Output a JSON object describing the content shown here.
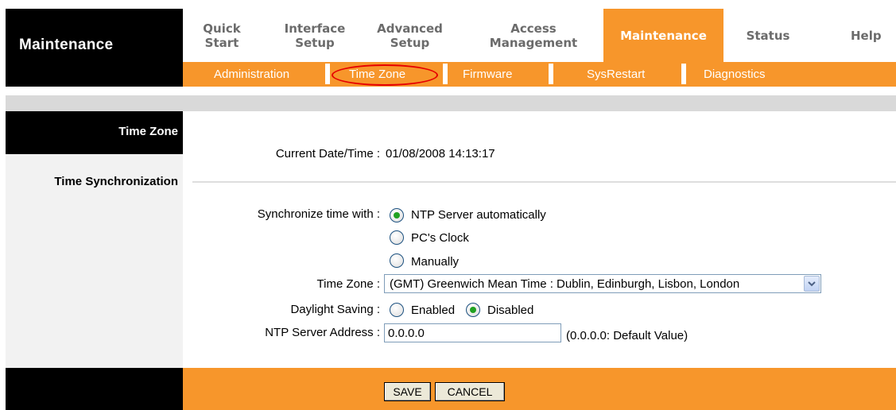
{
  "brand": {
    "title": "Maintenance"
  },
  "topnav": {
    "quick_start": [
      "Quick",
      "Start"
    ],
    "interface_setup": [
      "Interface",
      "Setup"
    ],
    "advanced_setup": [
      "Advanced",
      "Setup"
    ],
    "access_management": [
      "Access",
      "Management"
    ],
    "maintenance": "Maintenance",
    "status": "Status",
    "help": "Help"
  },
  "subnav": {
    "administration": "Administration",
    "time_zone": "Time Zone",
    "firmware": "Firmware",
    "sysrestart": "SysRestart",
    "diagnostics": "Diagnostics"
  },
  "left": {
    "header": "Time Zone",
    "section": "Time Synchronization"
  },
  "form": {
    "current_datetime_label": "Current Date/Time :",
    "current_datetime_value": "01/08/2008 14:13:17",
    "sync_label": "Synchronize time with :",
    "sync_options": [
      "NTP Server automatically",
      "PC's Clock",
      "Manually"
    ],
    "sync_selected": "NTP Server automatically",
    "timezone_label": "Time Zone :",
    "timezone_value": "(GMT) Greenwich Mean Time : Dublin, Edinburgh, Lisbon, London",
    "daylight_label": "Daylight Saving :",
    "daylight_options": [
      "Enabled",
      "Disabled"
    ],
    "daylight_selected": "Disabled",
    "ntp_label": "NTP Server Address :",
    "ntp_value": "0.0.0.0",
    "ntp_hint": "(0.0.0.0: Default Value)"
  },
  "buttons": {
    "save": "SAVE",
    "cancel": "CANCEL"
  },
  "colors": {
    "accent": "#f7962b",
    "highlight": "#e60000"
  }
}
